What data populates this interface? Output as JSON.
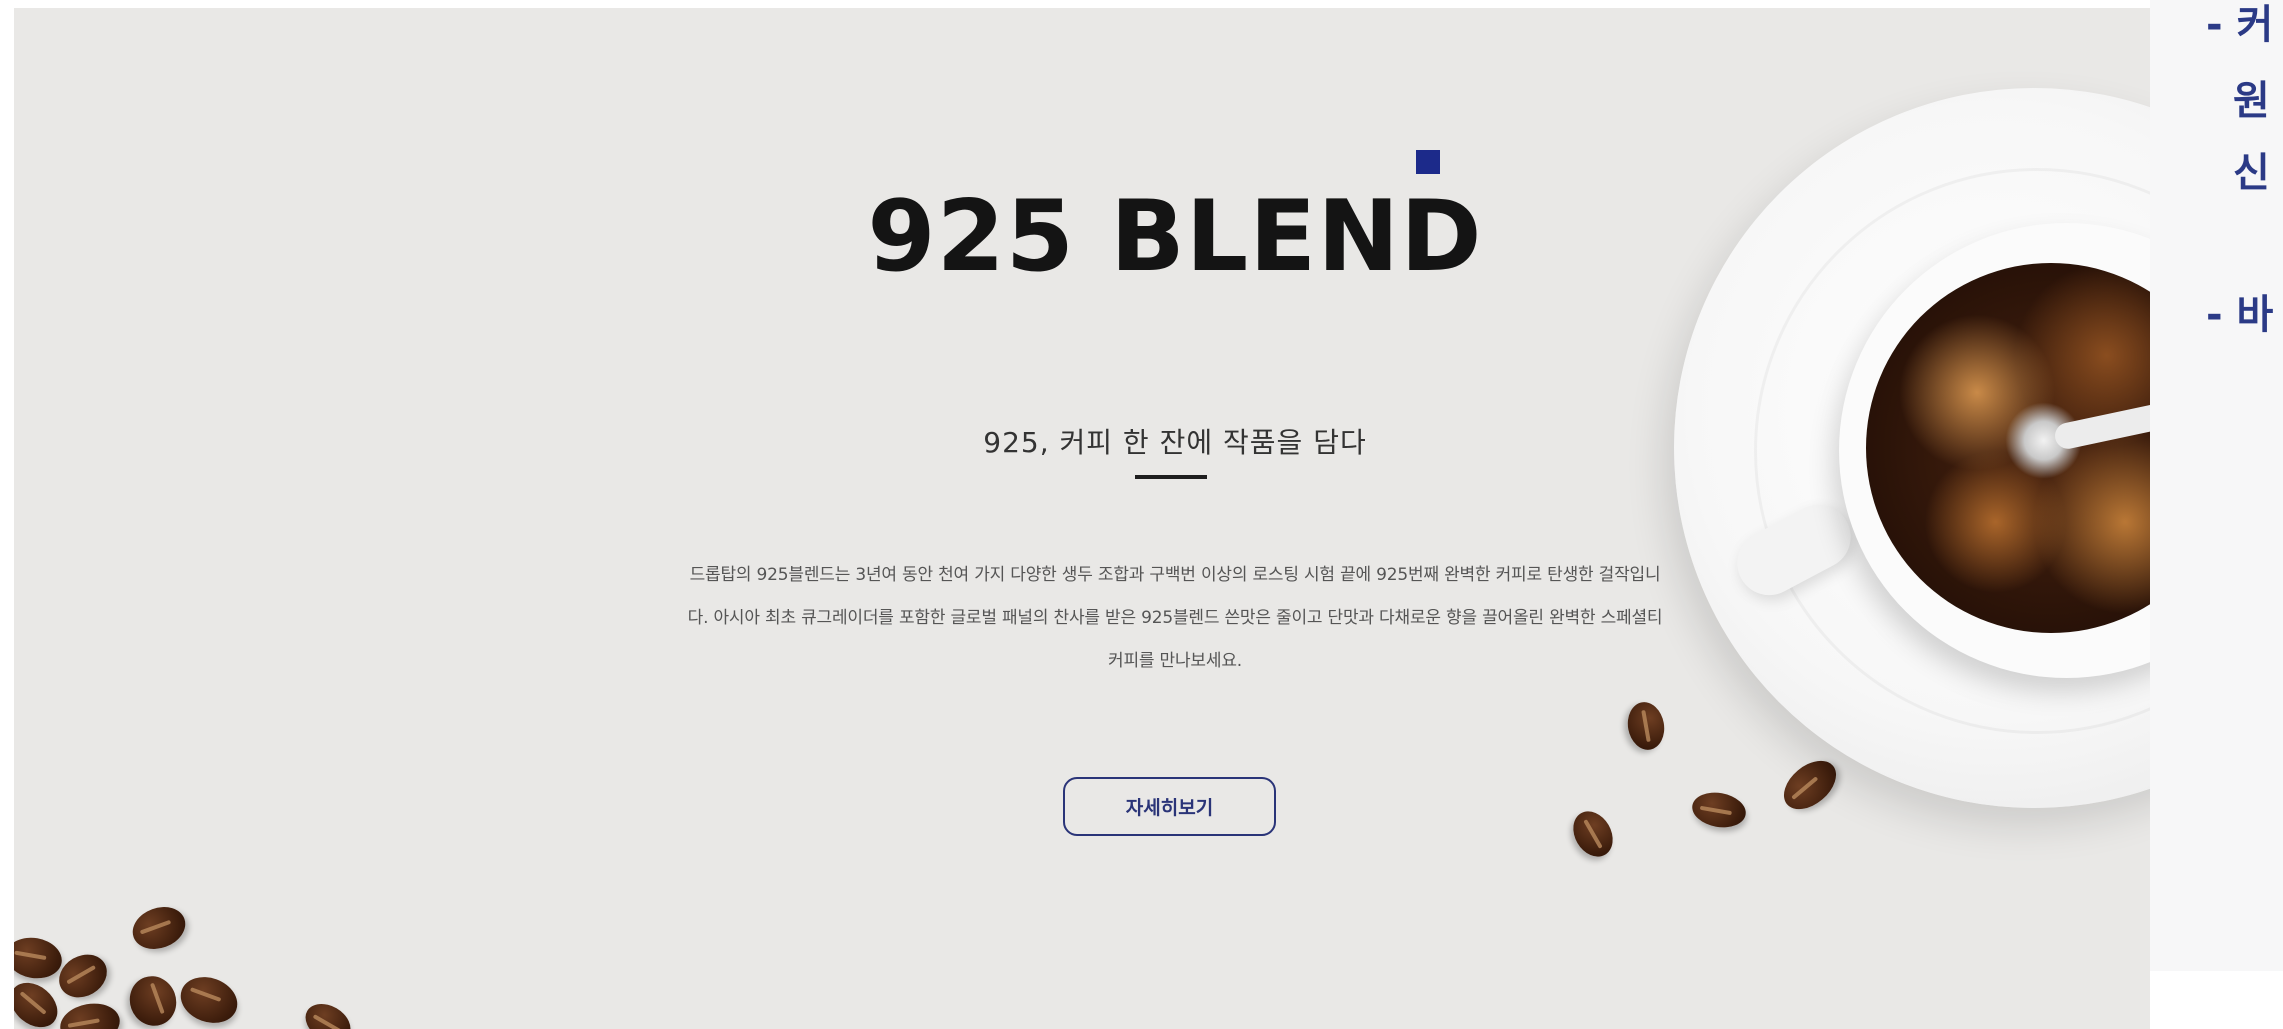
{
  "hero": {
    "title": "925 BLEND",
    "subtitle": "925, 커피 한 잔에 작품을 담다",
    "description": "드롭탑의 925블렌드는 3년여 동안 천여 가지 다양한 생두 조합과 구백번 이상의 로스팅 시험 끝에 925번째 완벽한 커피로 탄생한 걸작입니다. 아시아 최초 큐그레이더를 포함한 글로벌 패널의 찬사를 받은 925블렌드 쓴맛은 줄이고 단맛과 다채로운 향을 끌어올린 완벽한 스페셜티 커피를 만나보세요.",
    "detail_button": "자세히보기",
    "accent_color": "#1c2a8a",
    "background_color": "#e9e8e6"
  },
  "side_panel": {
    "line1": "- 커",
    "line2": "원",
    "line3": "신",
    "line4": "- 바"
  },
  "icons": [
    "coffee-cup-image",
    "coffee-bean"
  ]
}
